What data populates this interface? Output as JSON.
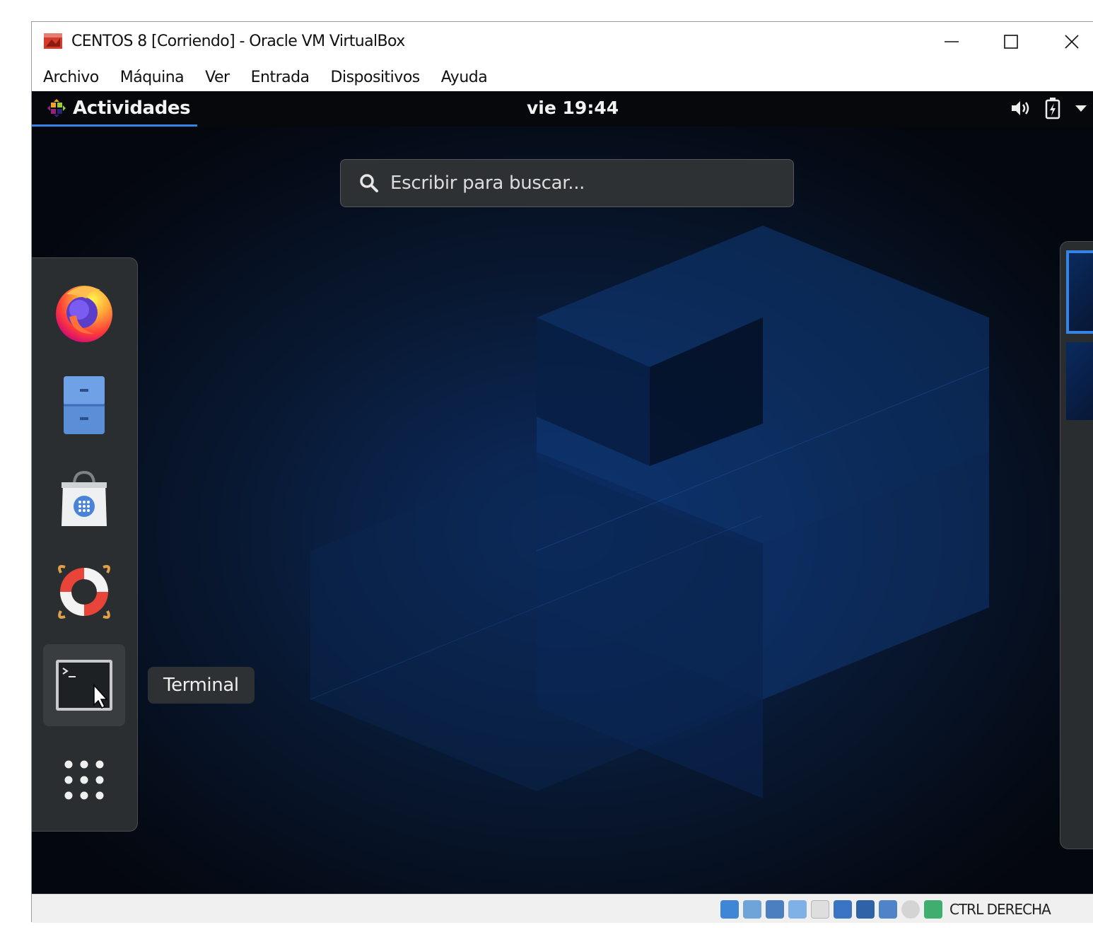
{
  "window": {
    "title": "CENTOS 8 [Corriendo] - Oracle VM VirtualBox"
  },
  "menubar": {
    "items": [
      "Archivo",
      "Máquina",
      "Ver",
      "Entrada",
      "Dispositivos",
      "Ayuda"
    ]
  },
  "topbar": {
    "activities_label": "Actividades",
    "clock": "vie 19:44"
  },
  "search": {
    "placeholder": "Escribir para buscar..."
  },
  "dash": {
    "items": [
      {
        "name": "firefox",
        "icon": "firefox-icon"
      },
      {
        "name": "files",
        "icon": "file-cabinet-icon"
      },
      {
        "name": "software",
        "icon": "shopping-bag-icon"
      },
      {
        "name": "help",
        "icon": "lifebuoy-icon"
      },
      {
        "name": "terminal",
        "icon": "terminal-icon"
      },
      {
        "name": "show-applications",
        "icon": "app-grid-icon"
      }
    ],
    "tooltip": "Terminal"
  },
  "statusbar": {
    "host_key": "CTRL DERECHA"
  },
  "colors": {
    "accent": "#3584e4",
    "topbar": "#06080b",
    "dash_bg": "#2b2e30",
    "statusbar": "#f0f0f0"
  }
}
